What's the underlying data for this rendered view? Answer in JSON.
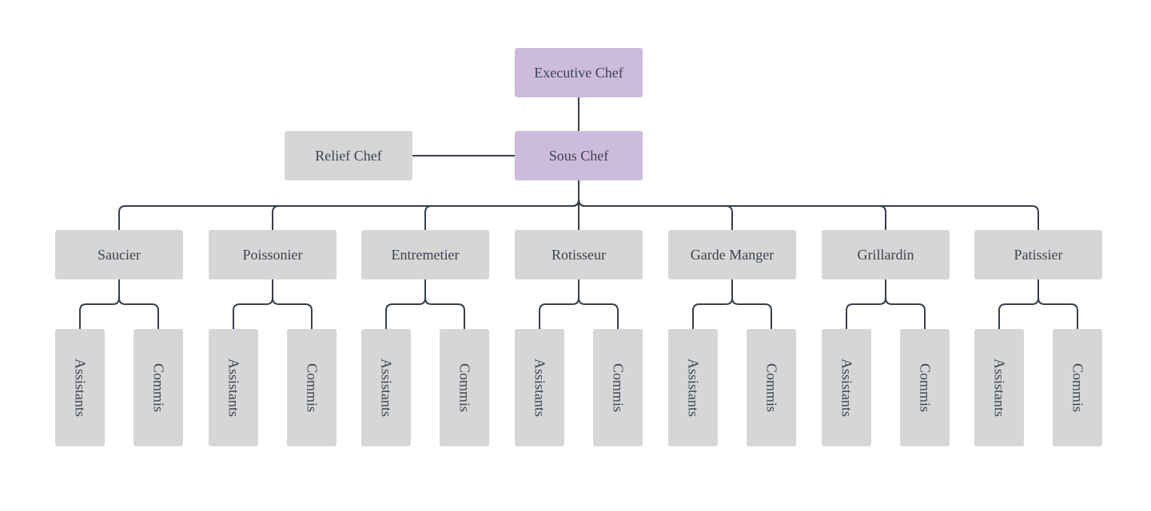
{
  "colors": {
    "executive": "#cdbbdc",
    "staff": "#d6d6d6",
    "line": "#36404a",
    "text": "#3b4451"
  },
  "executive": {
    "label": "Executive Chef"
  },
  "sous": {
    "label": "Sous Chef"
  },
  "relief": {
    "label": "Relief Chef"
  },
  "stations": [
    {
      "label": "Saucier",
      "children": [
        "Assistants",
        "Commis"
      ]
    },
    {
      "label": "Poissonier",
      "children": [
        "Assistants",
        "Commis"
      ]
    },
    {
      "label": "Entremetier",
      "children": [
        "Assistants",
        "Commis"
      ]
    },
    {
      "label": "Rotisseur",
      "children": [
        "Assistants",
        "Commis"
      ]
    },
    {
      "label": "Garde Manger",
      "children": [
        "Assistants",
        "Commis"
      ]
    },
    {
      "label": "Grillardin",
      "children": [
        "Assistants",
        "Commis"
      ]
    },
    {
      "label": "Patissier",
      "children": [
        "Assistants",
        "Commis"
      ]
    }
  ]
}
